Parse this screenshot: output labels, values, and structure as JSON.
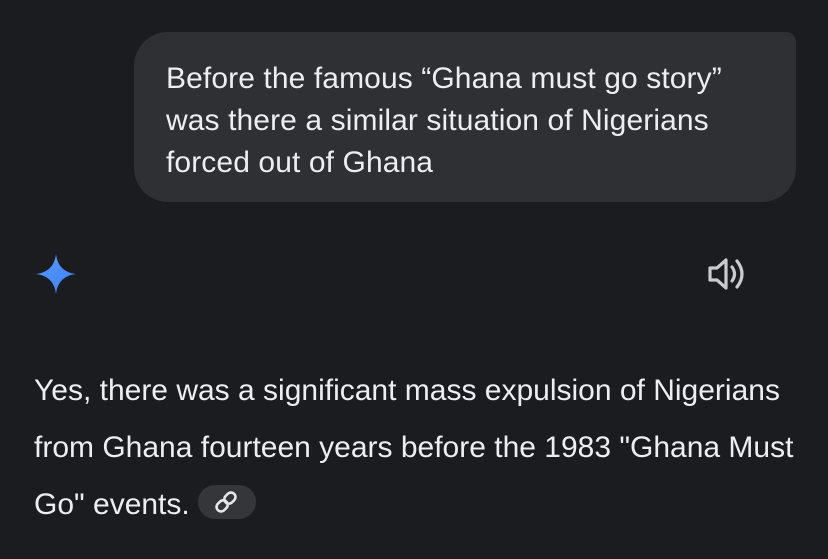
{
  "conversation": {
    "user_message": "Before the famous “Ghana must go story” was there a similar situation of Nigerians forced out of Ghana",
    "response_text": "Yes, there was a significant mass expulsion of Nigerians from Ghana fourteen years before the 1983 \"Ghana Must Go\" events."
  },
  "icons": {
    "assistant": "sparkle-icon",
    "read_aloud": "speaker-icon",
    "source_link": "link-icon"
  },
  "colors": {
    "background": "#1b1c1f",
    "bubble": "#2f3033",
    "text": "#eceef1",
    "sparkle_accent": "#4b8df8",
    "chip": "#34363a"
  }
}
